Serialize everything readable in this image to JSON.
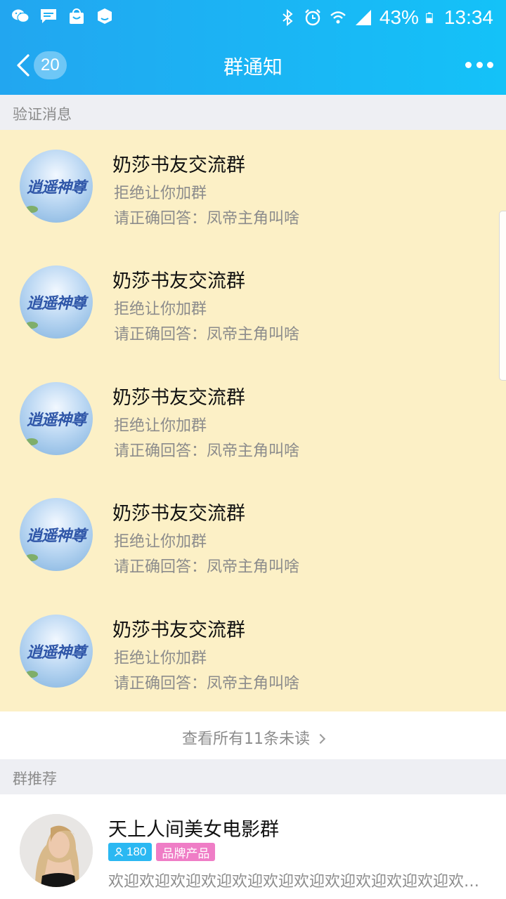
{
  "status_bar": {
    "battery": "43%",
    "time": "13:34",
    "left_icons": [
      "wechat-icon",
      "message-icon",
      "shopping-bag-icon",
      "qq-icon"
    ],
    "right_icons": [
      "bluetooth-icon",
      "alarm-icon",
      "wifi-icon",
      "signal-icon",
      "battery-icon"
    ]
  },
  "nav": {
    "back_count": "20",
    "title": "群通知"
  },
  "verify_section": {
    "header": "验证消息",
    "items": [
      {
        "group": "奶莎书友交流群",
        "status": "拒绝让你加群",
        "answer": "请正确回答：凤帝主角叫啥",
        "avatar_text": "逍遥神尊"
      },
      {
        "group": "奶莎书友交流群",
        "status": "拒绝让你加群",
        "answer": "请正确回答：凤帝主角叫啥",
        "avatar_text": "逍遥神尊"
      },
      {
        "group": "奶莎书友交流群",
        "status": "拒绝让你加群",
        "answer": "请正确回答：凤帝主角叫啥",
        "avatar_text": "逍遥神尊"
      },
      {
        "group": "奶莎书友交流群",
        "status": "拒绝让你加群",
        "answer": "请正确回答：凤帝主角叫啥",
        "avatar_text": "逍遥神尊"
      },
      {
        "group": "奶莎书友交流群",
        "status": "拒绝让你加群",
        "answer": "请正确回答：凤帝主角叫啥",
        "avatar_text": "逍遥神尊"
      }
    ],
    "view_all": "查看所有11条未读"
  },
  "recommend_section": {
    "header": "群推荐",
    "item": {
      "name": "天上人间美女电影群",
      "members": "180",
      "brand_tag": "品牌产品",
      "description": "欢迎欢迎欢迎欢迎欢迎欢迎欢迎欢迎欢迎欢迎欢迎欢迎..."
    }
  },
  "colors": {
    "header_gradient_start": "#22a6f0",
    "header_gradient_end": "#14c2f8",
    "highlight_bg": "#fcf0c6",
    "section_bg": "#eeeff3",
    "members_tag": "#2bb8f2",
    "brand_tag": "#ef7dc6"
  }
}
